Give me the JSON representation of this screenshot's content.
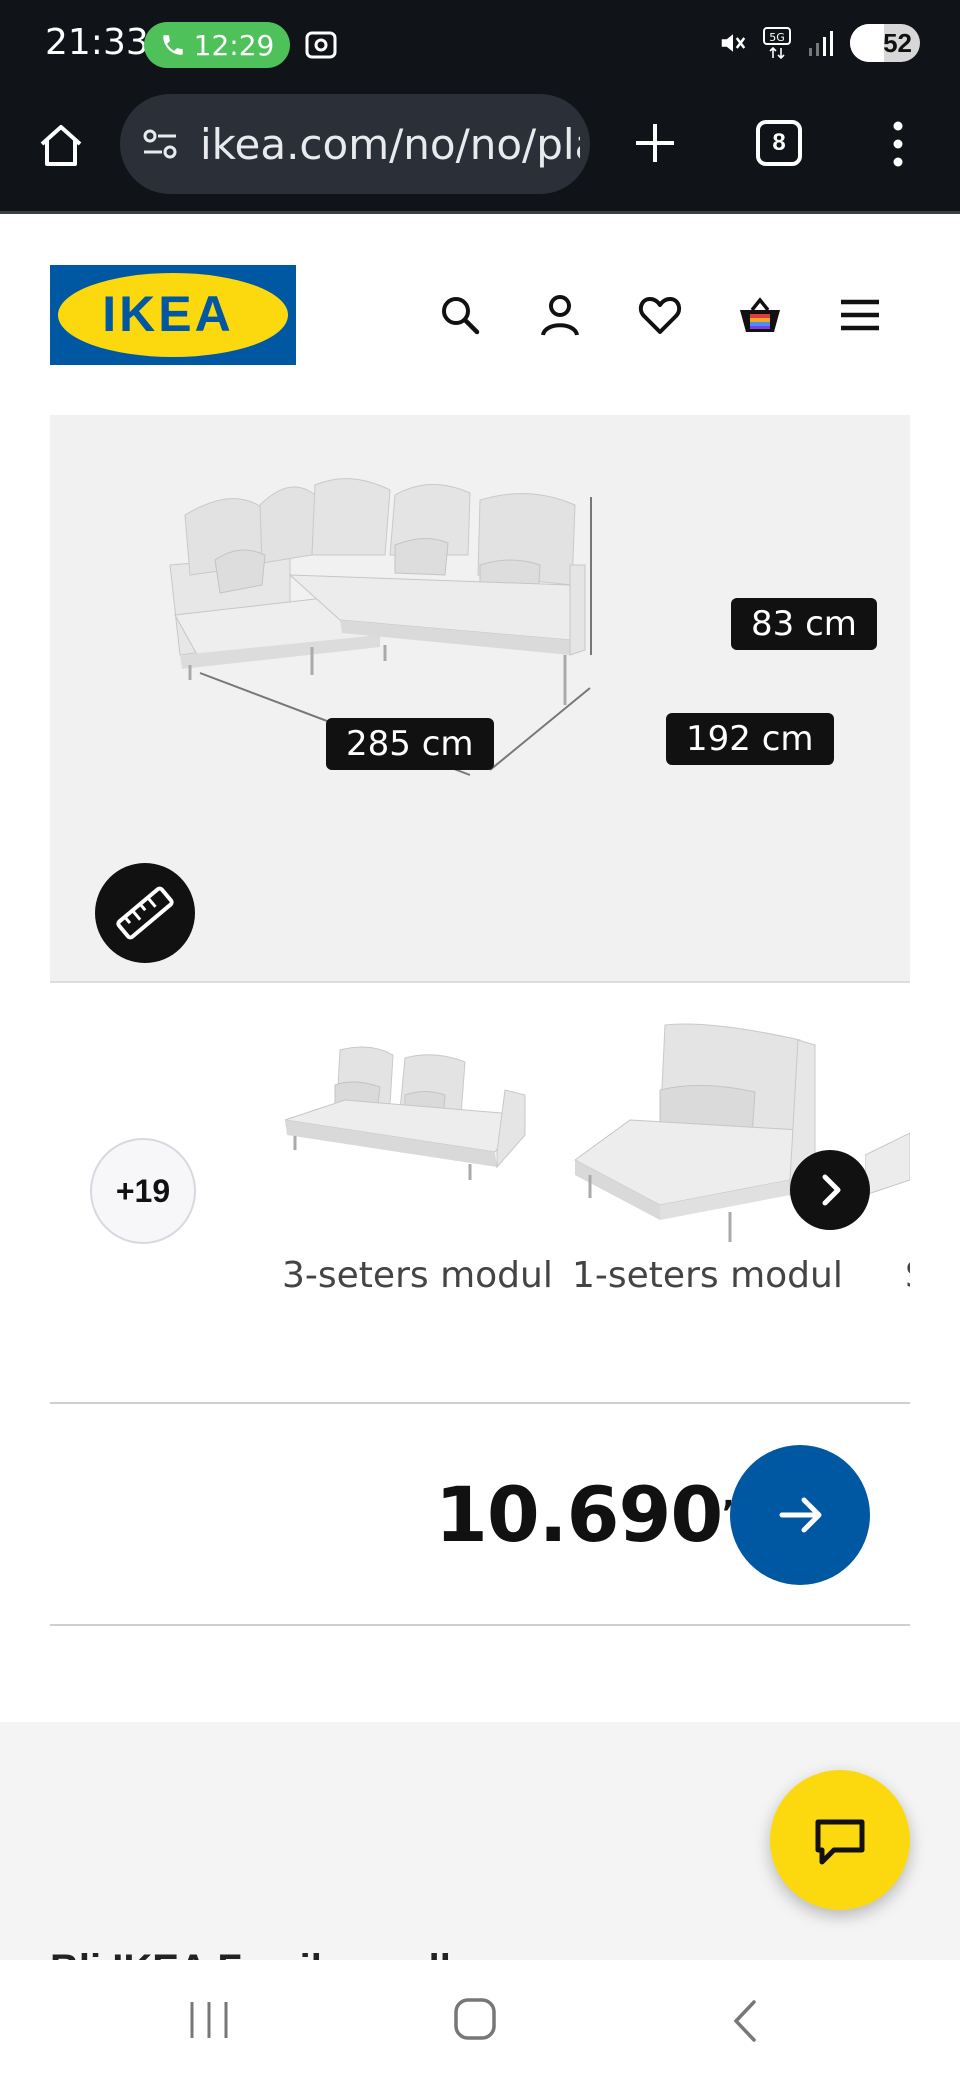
{
  "status_bar": {
    "time": "21:33",
    "call_timer": "12:29",
    "battery": "52"
  },
  "browser": {
    "url": "ikea.com/no/no/pla",
    "tab_count": "8"
  },
  "header": {
    "logo_text": "IKEA",
    "icons": [
      "search-icon",
      "account-icon",
      "heart-icon",
      "basket-icon",
      "menu-icon"
    ]
  },
  "product_image": {
    "dimensions": {
      "height": "83 cm",
      "width": "285 cm",
      "depth": "192 cm"
    }
  },
  "variants": {
    "more_count": "+19",
    "items": [
      {
        "label": "3-seters modul"
      },
      {
        "label": "1-seters modul"
      },
      {
        "label": "S"
      }
    ]
  },
  "price": {
    "amount": "10.690",
    "suffix": ",-"
  },
  "promo": {
    "text": "Bli IKEA Family-medlem"
  },
  "colors": {
    "ikea_blue": "#0058a3",
    "ikea_yellow": "#fcd90f",
    "chrome_dark": "#101318"
  }
}
